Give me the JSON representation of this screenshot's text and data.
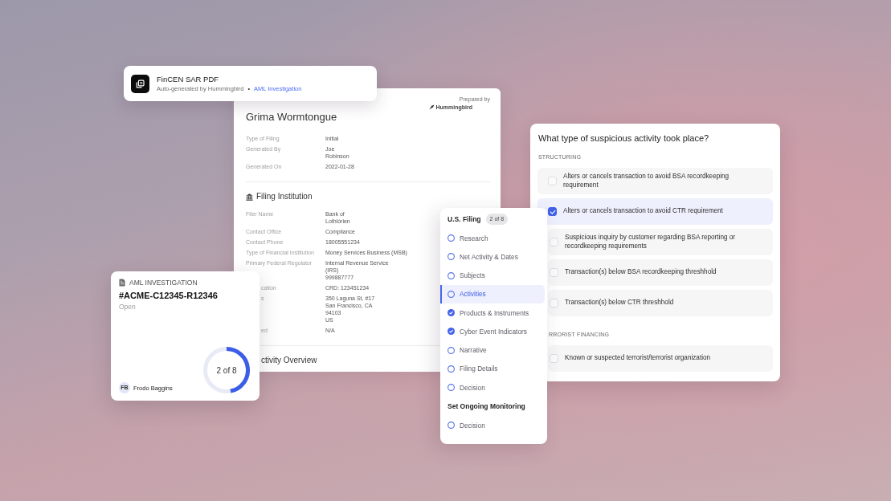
{
  "export_card": {
    "title": "FinCEN SAR PDF",
    "subtitle": "Auto-generated by Hummingbird",
    "separator": "•",
    "link": "AML Investigation"
  },
  "report": {
    "prepared_by": "Prepared by",
    "brand": "Hummingbird",
    "subject": "Grima Wormtongue",
    "fields": [
      {
        "label": "Type of Filing",
        "value": "Initial"
      },
      {
        "label": "Generated By",
        "value": "Joe\nRobinson"
      },
      {
        "label": "Generated On",
        "value": "2022-01-28"
      }
    ],
    "sections": [
      {
        "heading": "Filing Institution",
        "fields": [
          {
            "label": "Filer Name",
            "value": "Bank of\nLothlórien"
          },
          {
            "label": "Contact Office",
            "value": "Compliance"
          },
          {
            "label": "Contact Phone",
            "value": "18005551234"
          },
          {
            "label": "Type of Financial Institution",
            "value": "Money Services Business (MSB)"
          },
          {
            "label": "Primary Federal Regulator",
            "value": "Internal Revenue Service\n(IRS)\n999887777"
          },
          {
            "label": "cation",
            "value": "CRD: 123451234"
          },
          {
            "label": "s",
            "value": "350 Laguna St, #17\nSan Francisco, CA\n94103\nUS"
          },
          {
            "label": "ed",
            "value": "N/A"
          }
        ]
      },
      {
        "heading": "ctivity Overview"
      }
    ]
  },
  "case_card": {
    "type_label": "AML INVESTIGATION",
    "case_id": "#ACME-C12345-R12346",
    "status": "Open",
    "progress": {
      "label": "2 of 8",
      "level": 0.47
    },
    "assignee": {
      "initials": "FB",
      "name": "Frodo Baggins"
    }
  },
  "filing_steps": {
    "sections": [
      {
        "title": "U.S. Filing",
        "badge": "2 of 8",
        "steps": [
          {
            "label": "Research",
            "done": false,
            "selected": false
          },
          {
            "label": "Net Activity & Dates",
            "done": false,
            "selected": false
          },
          {
            "label": "Subjects",
            "done": false,
            "selected": false
          },
          {
            "label": "Activities",
            "done": false,
            "selected": true
          },
          {
            "label": "Products & Instruments",
            "done": true,
            "selected": false
          },
          {
            "label": "Cyber Event Indicators",
            "done": true,
            "selected": false
          },
          {
            "label": "Narrative",
            "done": false,
            "selected": false
          },
          {
            "label": "Filing Details",
            "done": false,
            "selected": false
          },
          {
            "label": "Decision",
            "done": false,
            "selected": false
          }
        ]
      },
      {
        "title": "Set Ongoing Monitoring",
        "steps": [
          {
            "label": "Decision",
            "done": false,
            "selected": false
          }
        ]
      }
    ]
  },
  "question": {
    "title": "What type of suspicious activity took place?",
    "groups": [
      {
        "heading": "STRUCTURING",
        "options": [
          {
            "label": "Alters or cancels transaction to avoid BSA recordkeeping requirement",
            "checked": false
          },
          {
            "label": "Alters or cancels transaction to avoid CTR requirement",
            "checked": true
          },
          {
            "label": "Suspicious inquiry by customer regarding BSA reporting or recordkeeping requirements",
            "checked": false
          },
          {
            "label": "Transaction(s) below BSA recordkeeping threshhold",
            "checked": false
          },
          {
            "label": "Transaction(s) below CTR threshhold",
            "checked": false
          }
        ]
      },
      {
        "heading": "RRORIST FINANCING",
        "options": [
          {
            "label": "Known or suspected terrorist/terrorist organization",
            "checked": false
          }
        ]
      }
    ]
  }
}
